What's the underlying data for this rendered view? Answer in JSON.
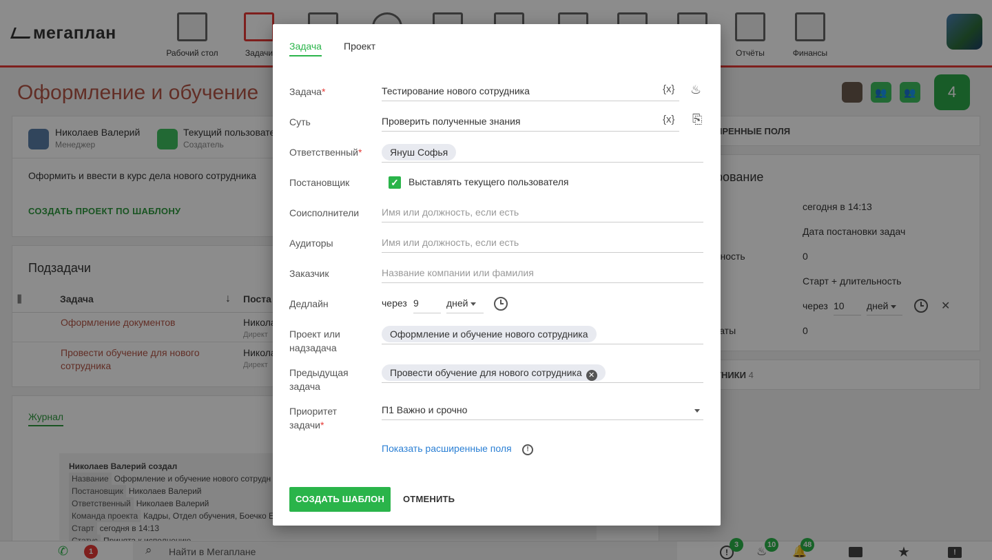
{
  "app": {
    "logo": "мегаплан"
  },
  "nav": [
    {
      "label": "Рабочий стол"
    },
    {
      "label": "Задачи"
    },
    {
      "label": ""
    },
    {
      "label": ""
    },
    {
      "label": ""
    },
    {
      "label": ""
    },
    {
      "label": ""
    },
    {
      "label": ""
    },
    {
      "label": ""
    },
    {
      "label": "Отчёты"
    },
    {
      "label": "Финансы"
    }
  ],
  "page": {
    "title": "Оформление и обучение",
    "participants_count": "4",
    "people": [
      {
        "name": "Николаев Валерий",
        "role": "Менеджер"
      },
      {
        "name": "Текущий пользовате",
        "role": "Создатель"
      }
    ],
    "description": "Оформить и ввести в курс дела нового сотрудника",
    "create_project_link": "СОЗДАТЬ ПРОЕКТ ПО ШАБЛОНУ",
    "subtasks": {
      "title": "Подзадачи",
      "col_task": "Задача",
      "col_owner": "Поста",
      "rows": [
        {
          "task": "Оформление документов",
          "owner": "Никола",
          "owner_role": "Директ"
        },
        {
          "task": "Провести обучение для нового сотрудника",
          "owner": "Никола",
          "owner_role": "Директ"
        }
      ]
    },
    "journal": {
      "tab": "Журнал",
      "author": "Николаев Валерий создал",
      "entries": [
        {
          "key": "Название",
          "value": "Оформление и обучение нового сотрудн"
        },
        {
          "key": "Постановщик",
          "value": "Николаев Валерий"
        },
        {
          "key": "Ответственный",
          "value": "Николаев Валерий"
        },
        {
          "key": "Команда проекта",
          "value": "Кадры, Отдел обучения, Боечко Е"
        },
        {
          "key": "Старт",
          "value": "сегодня в 14:13"
        },
        {
          "key": "Статус",
          "value": "Принята к исполнению"
        }
      ]
    },
    "right_panel": {
      "ext_fields": "ИРЕННЫЕ ПОЛЯ",
      "planning_title": "рование",
      "rows": [
        {
          "label": "а",
          "value": "сегодня в 14:13"
        },
        {
          "label": "",
          "value": "Дата постановки задач"
        },
        {
          "label": "льность",
          "value": "0"
        },
        {
          "label": "",
          "value": "Старт + длительность"
        },
        {
          "label": "н",
          "value": "через"
        },
        {
          "label": "траты",
          "value": "0"
        }
      ],
      "deadline_num": "10",
      "deadline_unit": "дней",
      "participants_label": "ТНИКИ",
      "participants_count": "4"
    }
  },
  "bottom_bar": {
    "search_placeholder": "Найти в Мегаплане",
    "badges": {
      "calls": "1",
      "alerts": "3",
      "fire": "10",
      "bell": "48"
    }
  },
  "modal": {
    "tabs": [
      "Задача",
      "Проект"
    ],
    "fields": {
      "task": {
        "label": "Задача",
        "value": "Тестирование нового сотрудника"
      },
      "essence": {
        "label": "Суть",
        "value": "Проверить полученные знания"
      },
      "responsible": {
        "label": "Ответственный",
        "chip": "Януш Софья"
      },
      "setter": {
        "label": "Постановщик",
        "checkbox_label": "Выставлять текущего пользователя"
      },
      "coexecutors": {
        "label": "Соисполнители",
        "placeholder": "Имя или должность, если есть"
      },
      "auditors": {
        "label": "Аудиторы",
        "placeholder": "Имя или должность, если есть"
      },
      "customer": {
        "label": "Заказчик",
        "placeholder": "Название компании или фамилия"
      },
      "deadline": {
        "label": "Дедлайн",
        "prefix": "через",
        "value": "9",
        "unit": "дней"
      },
      "project": {
        "label_line1": "Проект или",
        "label_line2": "надзадача",
        "chip": "Оформление и обучение нового сотрудника"
      },
      "previous": {
        "label_line1": "Предыдущая",
        "label_line2": "задача",
        "chip": "Провести обучение для нового сотрудника"
      },
      "priority": {
        "label_line1": "Приоритет",
        "label_line2": "задачи",
        "value": "П1 Важно и срочно"
      }
    },
    "var_token": "{x}",
    "show_ext": "Показать расширенные поля",
    "create_btn": "СОЗДАТЬ ШАБЛОН",
    "cancel_btn": "ОТМЕНИТЬ"
  }
}
